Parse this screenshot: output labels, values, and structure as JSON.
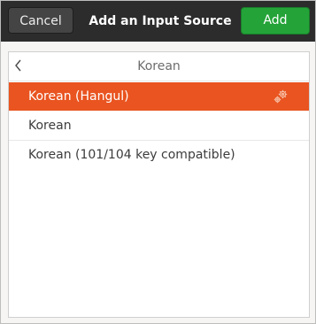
{
  "header": {
    "cancel_label": "Cancel",
    "title": "Add an Input Source",
    "add_label": "Add",
    "add_color": "#23a338"
  },
  "list": {
    "title": "Korean",
    "back_icon": "chevron-left-icon",
    "selected_color": "#e95420",
    "items": [
      {
        "label": "Korean (Hangul)",
        "selected": true,
        "icon": "gears-icon"
      },
      {
        "label": "Korean",
        "selected": false
      },
      {
        "label": "Korean (101/104 key compatible)",
        "selected": false
      }
    ]
  }
}
